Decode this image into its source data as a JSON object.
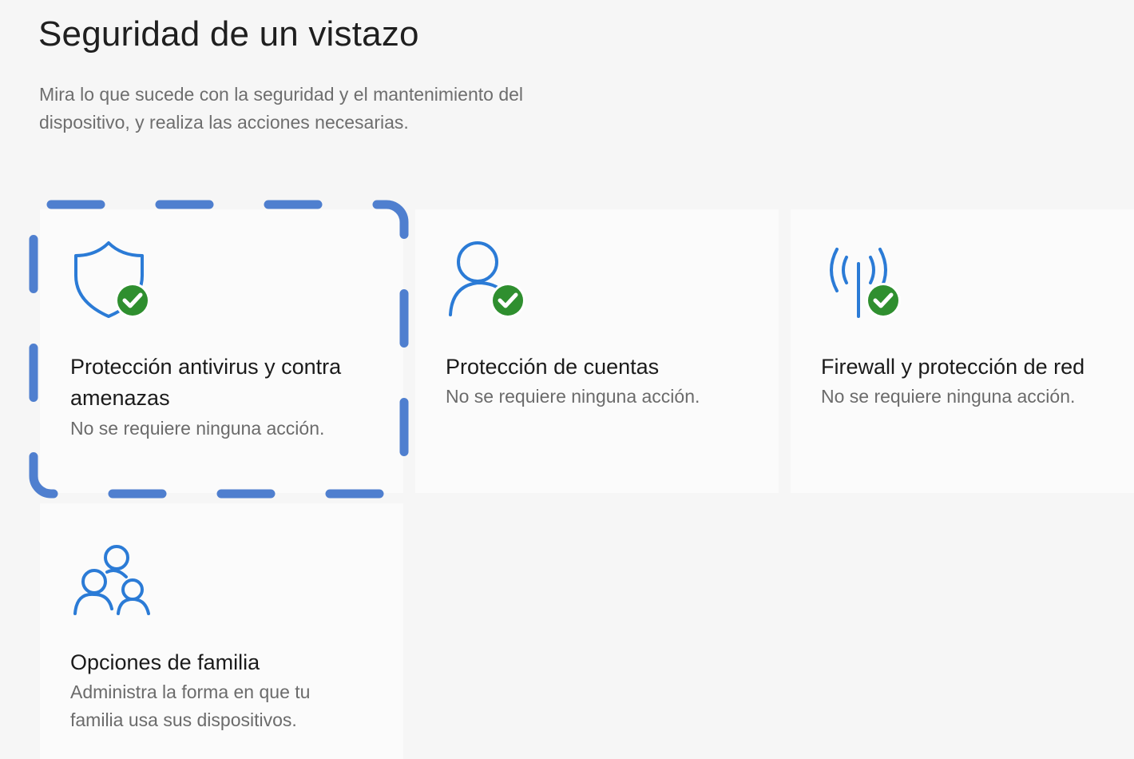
{
  "header": {
    "title": "Seguridad de un vistazo",
    "description": "Mira lo que sucede con la seguridad y el mantenimiento del dispositivo, y realiza las acciones necesarias."
  },
  "tiles": [
    {
      "id": "virus-threat-protection",
      "icon": "shield-check-icon",
      "title": "Protección antivirus y contra amenazas",
      "status": "No se requiere ninguna acción.",
      "focused": true
    },
    {
      "id": "account-protection",
      "icon": "person-check-icon",
      "title": "Protección de cuentas",
      "status": "No se requiere ninguna acción."
    },
    {
      "id": "firewall-network-protection",
      "icon": "antenna-check-icon",
      "title": "Firewall y protección de red",
      "status": "No se requiere ninguna acción."
    },
    {
      "id": "family-options",
      "icon": "family-icon",
      "title": "Opciones de familia",
      "status": "Administra la forma en que tu familia usa sus dispositivos."
    }
  ],
  "colors": {
    "accent_blue": "#2b7bd6",
    "ok_green": "#2f8f2f",
    "focus_ring": "#4f7fcf"
  }
}
